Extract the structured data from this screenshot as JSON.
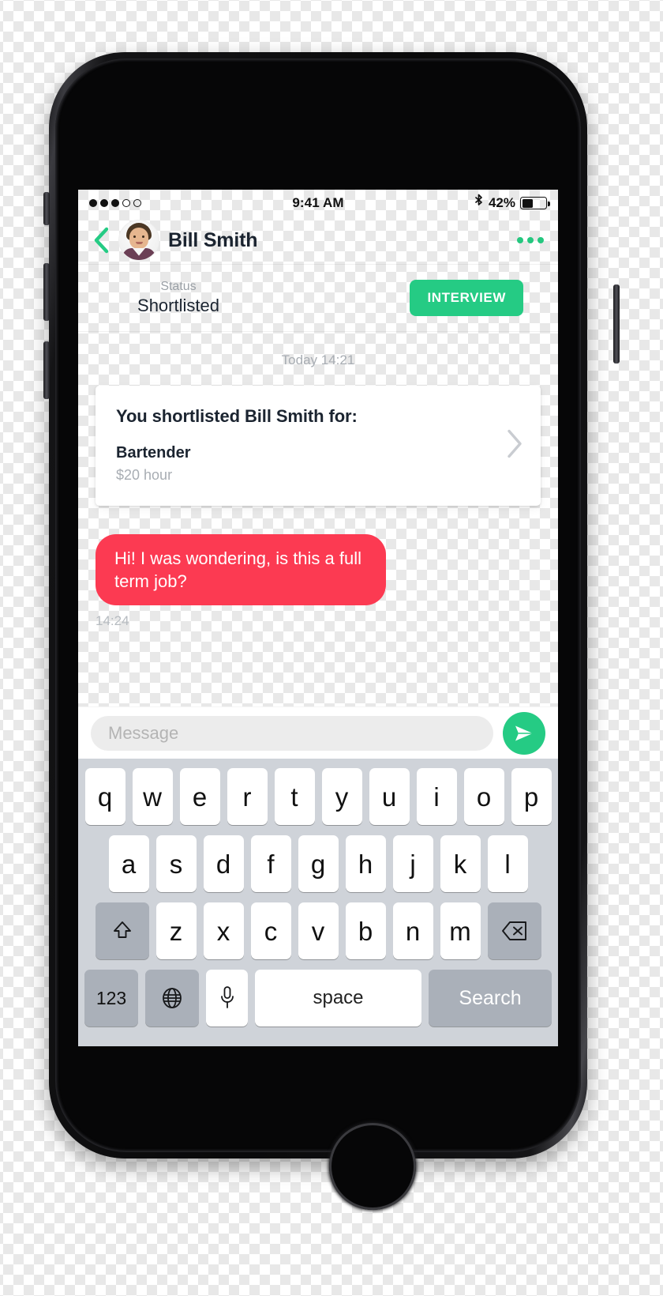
{
  "status_bar": {
    "signal_dots": [
      "on",
      "on",
      "on",
      "off",
      "off"
    ],
    "time": "9:41 AM",
    "bluetooth_icon": "bluetooth-icon",
    "battery_percent": "42%",
    "battery_level": 42
  },
  "nav": {
    "back_icon": "back-chevron-icon",
    "avatar_alt": "contact-avatar",
    "contact_name": "Bill Smith",
    "more_icon": "more-options-icon"
  },
  "status_row": {
    "label": "Status",
    "value": "Shortlisted",
    "action_label": "INTERVIEW",
    "action_color": "#25cb84"
  },
  "conversation": {
    "day_stamp": "Today 14:21",
    "job_card": {
      "title": "You shortlisted Bill Smith for:",
      "role": "Bartender",
      "rate": "$20 hour",
      "chevron_icon": "chevron-right-icon"
    },
    "messages": [
      {
        "text": "Hi! I was wondering, is this a full term job?",
        "time": "14:24",
        "color": "#fc3a52"
      }
    ]
  },
  "input_bar": {
    "placeholder": "Message",
    "value": "",
    "send_icon": "send-icon",
    "send_color": "#25cb84"
  },
  "keyboard": {
    "row1": [
      "q",
      "w",
      "e",
      "r",
      "t",
      "y",
      "u",
      "i",
      "o",
      "p"
    ],
    "row2": [
      "a",
      "s",
      "d",
      "f",
      "g",
      "h",
      "j",
      "k",
      "l"
    ],
    "row3_shift_icon": "shift-icon",
    "row3": [
      "z",
      "x",
      "c",
      "v",
      "b",
      "n",
      "m"
    ],
    "row3_backspace_icon": "backspace-icon",
    "numbers_label": "123",
    "globe_icon": "globe-icon",
    "mic_icon": "microphone-icon",
    "space_label": "space",
    "return_label": "Search"
  }
}
